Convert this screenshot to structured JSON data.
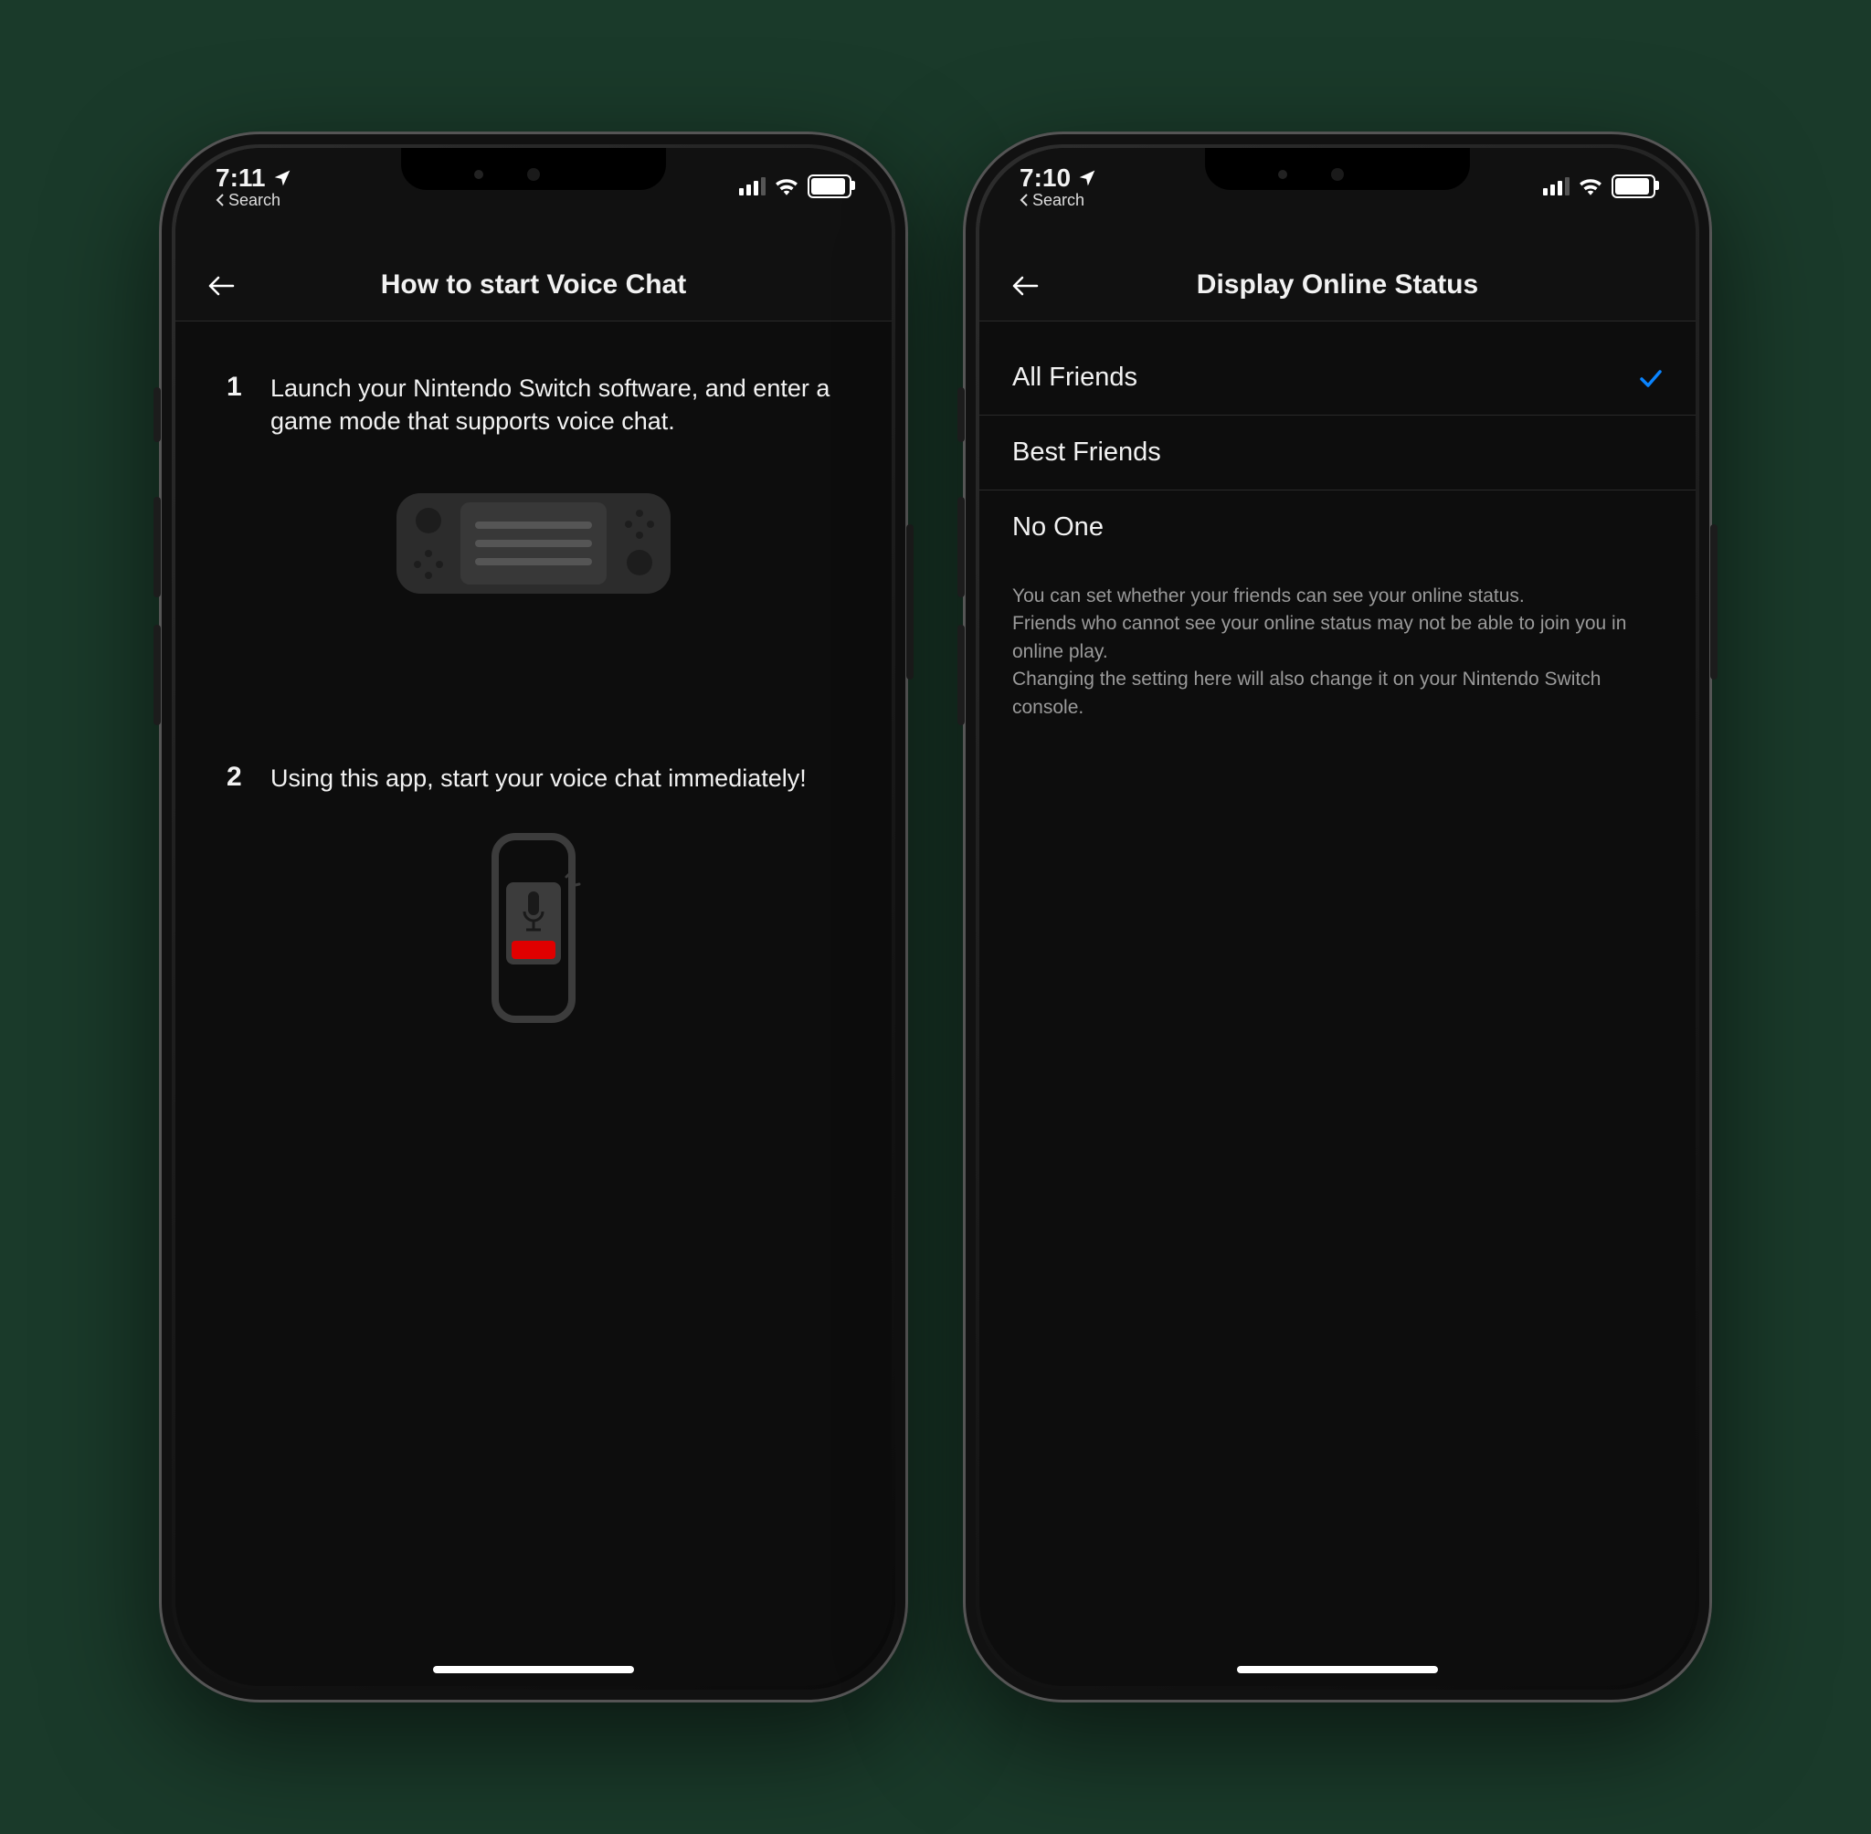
{
  "left": {
    "status": {
      "time": "7:11",
      "back_label": "Search"
    },
    "header": {
      "title": "How to start Voice Chat"
    },
    "steps": [
      {
        "num": "1",
        "text": "Launch your Nintendo Switch software, and enter a game mode that supports voice chat."
      },
      {
        "num": "2",
        "text": "Using this app, start your voice chat immediately!"
      }
    ]
  },
  "right": {
    "status": {
      "time": "7:10",
      "back_label": "Search"
    },
    "header": {
      "title": "Display Online Status"
    },
    "options": [
      {
        "label": "All Friends",
        "selected": true
      },
      {
        "label": "Best Friends",
        "selected": false
      },
      {
        "label": "No One",
        "selected": false
      }
    ],
    "help": "You can set whether your friends can see your online status.\nFriends who cannot see your online status may not be able to join you in online play.\nChanging the setting here will also change it on your Nintendo Switch console."
  }
}
